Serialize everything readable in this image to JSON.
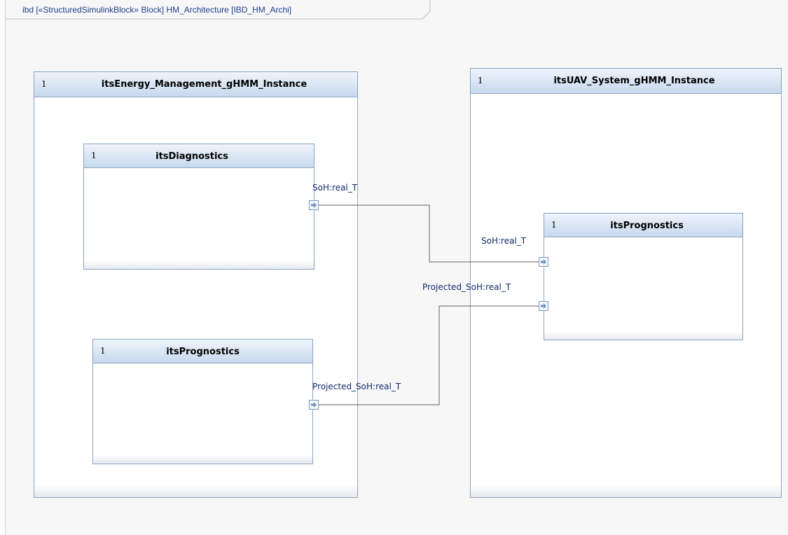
{
  "frame": {
    "title": "ibd [«StructuredSimulinkBlock» Block] HM_Architecture [IBD_HM_Archi]"
  },
  "blocks": {
    "energy_mgmt": {
      "multiplicity": "1",
      "name": "itsEnergy_Management_gHMM_Instance"
    },
    "uav_system": {
      "multiplicity": "1",
      "name": "itsUAV_System_gHMM_Instance"
    },
    "diagnostics": {
      "multiplicity": "1",
      "name": "itsDiagnostics"
    },
    "prognostics_left": {
      "multiplicity": "1",
      "name": "itsPrognostics"
    },
    "prognostics_right": {
      "multiplicity": "1",
      "name": "itsPrognostics"
    }
  },
  "ports": {
    "diag_out": {
      "label": "SoH:real_T"
    },
    "prog_left_out": {
      "label": "Projected_SoH:real_T"
    },
    "prog_right_in_soh": {
      "label": "SoH:real_T"
    },
    "prog_right_in_proj": {
      "label": "Projected_SoH:real_T"
    }
  },
  "colors": {
    "header_top": "#eef4fb",
    "header_bottom": "#c7d9ee",
    "border": "#8aa5c2",
    "label_text": "#102a6b",
    "frame_text": "#1d3f8a",
    "wire": "#606060"
  }
}
